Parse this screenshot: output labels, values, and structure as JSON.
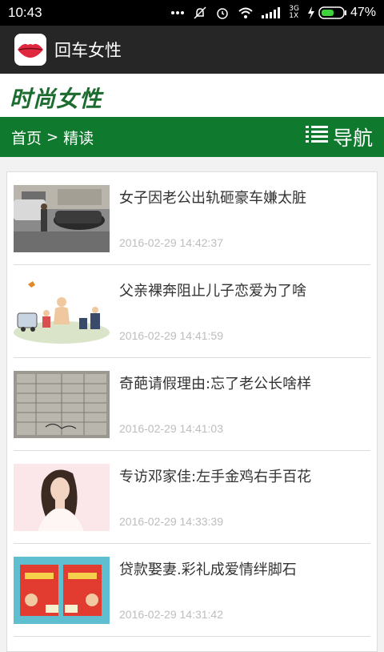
{
  "status_bar": {
    "time": "10:43",
    "icons": [
      "more-dots-icon",
      "mute-icon",
      "alarm-icon",
      "wifi-icon",
      "signal-icon",
      "charging-icon",
      "battery-icon"
    ],
    "network_top": "3G",
    "network_bottom": "1X",
    "battery_percent": "47%"
  },
  "app_bar": {
    "title": "回车女性",
    "icon": "lips-icon"
  },
  "brand": {
    "title": "时尚女性",
    "color": "#1c6b2f"
  },
  "nav": {
    "breadcrumb_home": "首页",
    "breadcrumb_separator": ">",
    "breadcrumb_current": "精读",
    "menu_label": "导航",
    "bar_color": "#0f7a2e"
  },
  "articles": [
    {
      "title": "女子因老公出轨砸豪车嫌太脏",
      "time": "2016-02-29 14:42:37"
    },
    {
      "title": "父亲裸奔阻止儿子恋爱为了啥",
      "time": "2016-02-29 14:41:59"
    },
    {
      "title": "奇葩请假理由:忘了老公长啥样",
      "time": "2016-02-29 14:41:03"
    },
    {
      "title": "专访邓家佳:左手金鸡右手百花",
      "time": "2016-02-29 14:33:39"
    },
    {
      "title": "贷款娶妻.彩礼成爱情绊脚石",
      "time": "2016-02-29 14:31:42"
    }
  ]
}
